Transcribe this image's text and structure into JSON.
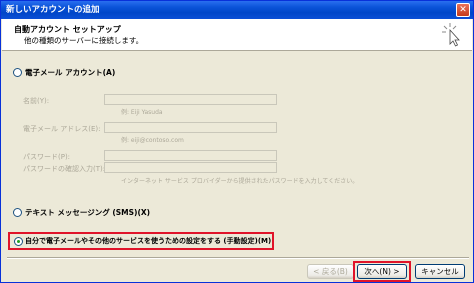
{
  "window": {
    "title": "新しいアカウントの追加",
    "close_glyph": "✕"
  },
  "header": {
    "title": "自動アカウント セットアップ",
    "subtitle": "他の種類のサーバーに接続します。"
  },
  "email_option": {
    "label": "電子メール アカウント(A)",
    "fields": [
      {
        "label": "名前(Y):",
        "value": "",
        "hint": "例: Eiji Yasuda"
      },
      {
        "label": "電子メール アドレス(E):",
        "value": "",
        "hint": "例: eiji@contoso.com"
      },
      {
        "label": "パスワード(P):",
        "value": ""
      },
      {
        "label": "パスワードの確認入力(T):",
        "value": "",
        "hint": "インターネット サービス プロバイダーから提供されたパスワードを入力してください。"
      }
    ]
  },
  "sms_option": {
    "label": "テキスト メッセージング (SMS)(X)"
  },
  "manual_option": {
    "label": "自分で電子メールやその他のサービスを使うための設定をする (手動設定)(M)"
  },
  "footer": {
    "back_label": "< 戻る(B)",
    "next_label": "次へ(N) >",
    "cancel_label": "キャンセル"
  },
  "colors": {
    "highlight": "#e0142a",
    "titlebar": "#0a53d8"
  }
}
